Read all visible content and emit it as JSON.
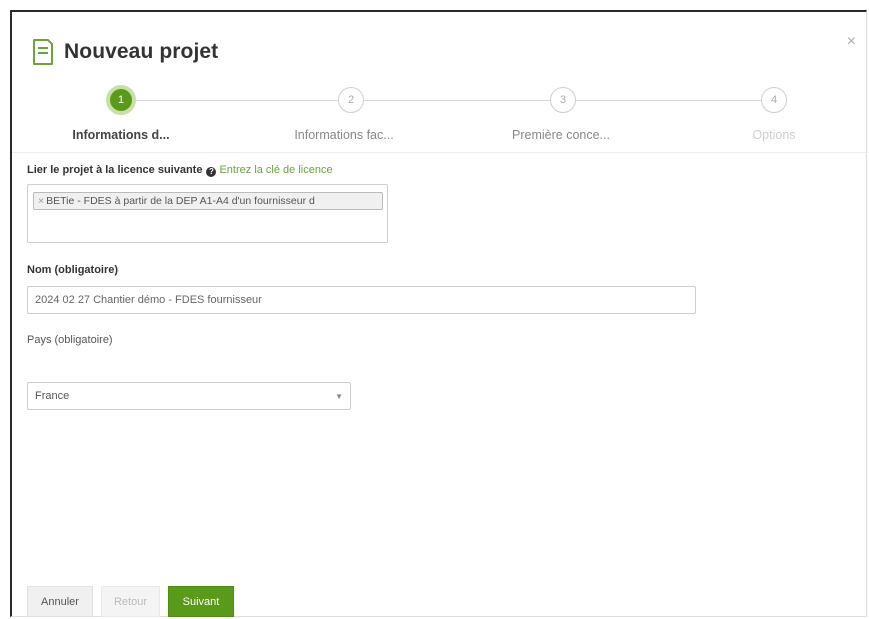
{
  "dialog": {
    "title": "Nouveau projet",
    "close_glyph": "×",
    "icon": "document-icon"
  },
  "steps": [
    {
      "number": "1",
      "label": "Informations d...",
      "state": "active"
    },
    {
      "number": "2",
      "label": "Informations fac...",
      "state": "pending"
    },
    {
      "number": "3",
      "label": "Première conce...",
      "state": "pending"
    },
    {
      "number": "4",
      "label": "Options",
      "state": "disabled"
    }
  ],
  "license": {
    "label": "Lier le projet à la licence suivante",
    "help_glyph": "?",
    "link": "Entrez la clé de licence",
    "remove_glyph": "×",
    "selected": "BETie - FDES à partir de la DEP A1-A4 d'un fournisseur d"
  },
  "name": {
    "label": "Nom (obligatoire)",
    "value": "2024 02 27 Chantier démo - FDES fournisseur"
  },
  "country": {
    "label": "Pays (obligatoire)",
    "selected": "France"
  },
  "buttons": {
    "cancel": "Annuler",
    "back": "Retour",
    "next": "Suivant"
  },
  "colors": {
    "accent": "#5a9a1a",
    "link": "#6aa53a"
  }
}
